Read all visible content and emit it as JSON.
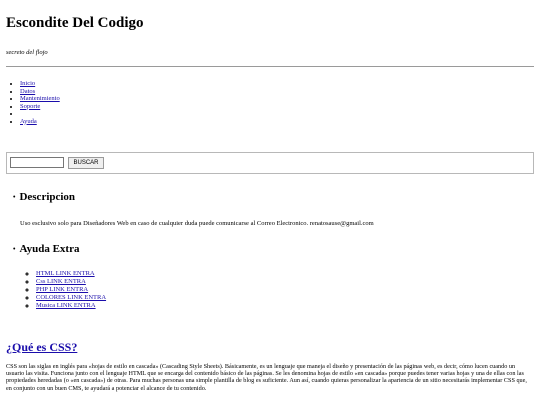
{
  "site": {
    "title": "Escondite Del Codigo",
    "tagline": "secreto del flojo"
  },
  "menu": {
    "items": [
      "Inicio",
      "Datos",
      "Mantenimiento",
      "Soporte",
      "",
      "Ayuda"
    ]
  },
  "search": {
    "value": "",
    "button_label": "BUSCAR"
  },
  "descripcion": {
    "heading": "Descripcion",
    "text": "Uso esclusivo solo para Diseñadores Web en caso de cualquier duda puede comunicarse al Correo Electronico. renatosause@gmail.com"
  },
  "ayuda_extra": {
    "heading": "Ayuda Extra",
    "links": [
      "HTML LINK ENTRA",
      "Css LINK ENTRA",
      "PHP LINK ENTRA",
      "COLORES LINK ENTRA",
      "Musica LINK ENTRA"
    ]
  },
  "css_section": {
    "title": "¿Qué es CSS?",
    "text": "CSS son las siglas en inglés para «hojas de estilo en cascada» (Cascading Style Sheets). Básicamente, es un lenguaje que maneja el diseño y presentación de las páginas web, es decir, cómo lucen cuando un usuario las visita. Funciona junto con el lenguaje HTML que se encarga del contenido básico de las páginas. Se les denomina hojas de estilo «en cascada» porque puedes tener varias hojas y una de ellas con las propiedades heredadas (o «en cascada») de otras. Para muchas personas una simple plantilla de blog es suficiente. Aun así, cuando quieras personalizar la apariencia de un sitio necesitarás implementar CSS que, en conjunto con un buen CMS, te ayudará a potenciar el alcance de tu contenido."
  },
  "colors": {
    "link": "#1a0dab",
    "divider": "#9a9a9a"
  }
}
